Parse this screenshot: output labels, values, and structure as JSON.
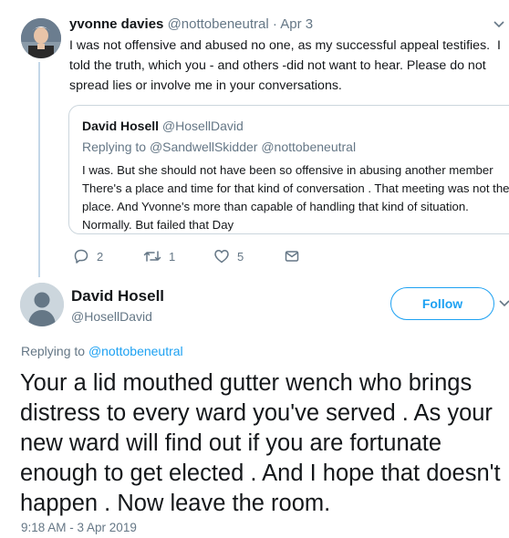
{
  "tweet1": {
    "name": "yvonne davies",
    "handle": "@nottobeneutral",
    "separator": "·",
    "date": "Apr 3",
    "text": "I was not offensive and abused no one, as my successful appeal testifies.  I told the truth, which you - and others -did not want to hear. Please do not spread lies or involve me in your conversations.",
    "quoted": {
      "name": "David Hosell",
      "handle": "@HosellDavid",
      "replying_label": "Replying to",
      "replying_to": "@SandwellSkidder @nottobeneutral",
      "text": "I was. But she should not have been so offensive in abusing another member There's a place and time for that kind of conversation . That meeting was not the place. And Yvonne's more than capable of handling that kind of situation. Normally. But failed that Day"
    },
    "actions": {
      "replies": "2",
      "retweets": "1",
      "likes": "5",
      "reply_icon": "reply-icon",
      "retweet_icon": "retweet-icon",
      "like_icon": "heart-icon",
      "message_icon": "envelope-icon"
    }
  },
  "main_tweet": {
    "name": "David Hosell",
    "handle": "@HosellDavid",
    "follow_label": "Follow",
    "replying_label": "Replying to",
    "replying_to": "@nottobeneutral",
    "text": "Your a lid mouthed gutter wench who brings distress to every ward you've served . As your new ward will find out if you are fortunate enough to get elected . And I hope that doesn't happen . Now leave the room.",
    "timestamp": "9:18 AM - 3 Apr 2019"
  },
  "colors": {
    "accent": "#1da1f2",
    "muted": "#657786",
    "text": "#14171a",
    "thread_line": "#c4d7e8",
    "border": "#ccd6dd"
  }
}
